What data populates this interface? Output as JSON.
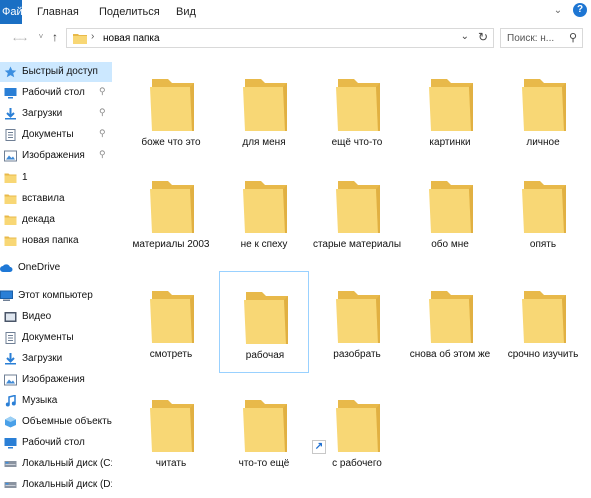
{
  "ribbon": {
    "file_tab": "Файл",
    "tabs": [
      "Главная",
      "Поделиться",
      "Вид"
    ],
    "help_label": "?"
  },
  "nav": {
    "back": "←",
    "forward": "→",
    "up": "↑",
    "path_sep": "›",
    "path": "новая папка",
    "search_placeholder": "Поиск: н..."
  },
  "sidebar": {
    "items": [
      {
        "label": "Быстрый доступ",
        "icon": "star-icon",
        "pinned": false
      },
      {
        "label": "Рабочий стол",
        "icon": "desktop-icon",
        "pinned": true
      },
      {
        "label": "Загрузки",
        "icon": "download-icon",
        "pinned": true
      },
      {
        "label": "Документы",
        "icon": "documents-icon",
        "pinned": true
      },
      {
        "label": "Изображения",
        "icon": "pictures-icon",
        "pinned": true
      },
      {
        "label": "1",
        "icon": "folder-icon",
        "pinned": false
      },
      {
        "label": "вставила",
        "icon": "folder-icon",
        "pinned": false
      },
      {
        "label": "декада",
        "icon": "folder-icon",
        "pinned": false
      },
      {
        "label": "новая папка",
        "icon": "folder-icon",
        "pinned": false
      },
      {
        "label": "OneDrive",
        "icon": "cloud-icon",
        "pinned": false
      },
      {
        "label": "Этот компьютер",
        "icon": "computer-icon",
        "pinned": false
      },
      {
        "label": "Видео",
        "icon": "video-icon",
        "pinned": false
      },
      {
        "label": "Документы",
        "icon": "documents-icon",
        "pinned": false
      },
      {
        "label": "Загрузки",
        "icon": "download-icon",
        "pinned": false
      },
      {
        "label": "Изображения",
        "icon": "pictures-icon",
        "pinned": false
      },
      {
        "label": "Музыка",
        "icon": "music-icon",
        "pinned": false
      },
      {
        "label": "Объемные объекты",
        "icon": "3d-objects-icon",
        "pinned": false
      },
      {
        "label": "Рабочий стол",
        "icon": "desktop-icon",
        "pinned": false
      },
      {
        "label": "Локальный диск (C:)",
        "icon": "drive-icon",
        "pinned": false
      },
      {
        "label": "Локальный диск (D:)",
        "icon": "drive-icon",
        "pinned": false
      }
    ]
  },
  "folders": [
    {
      "name": "боже что это"
    },
    {
      "name": "для меня"
    },
    {
      "name": "ещё что-то"
    },
    {
      "name": "картинки"
    },
    {
      "name": "личное"
    },
    {
      "name": "материалы 2003"
    },
    {
      "name": "не к спеху"
    },
    {
      "name": "старые материалы"
    },
    {
      "name": "обо мне"
    },
    {
      "name": "опять"
    },
    {
      "name": "смотреть"
    },
    {
      "name": "рабочая",
      "focused": true
    },
    {
      "name": "разобрать"
    },
    {
      "name": "снова об этом же"
    },
    {
      "name": "срочно изучить"
    },
    {
      "name": "читать"
    },
    {
      "name": "что-то ещё"
    },
    {
      "name": "с рабочего",
      "shortcut": true
    }
  ],
  "colors": {
    "folder_back": "#e8b94a",
    "folder_front": "#f8d775",
    "accent": "#1a6fc4",
    "selected_bg": "#cce8ff"
  }
}
